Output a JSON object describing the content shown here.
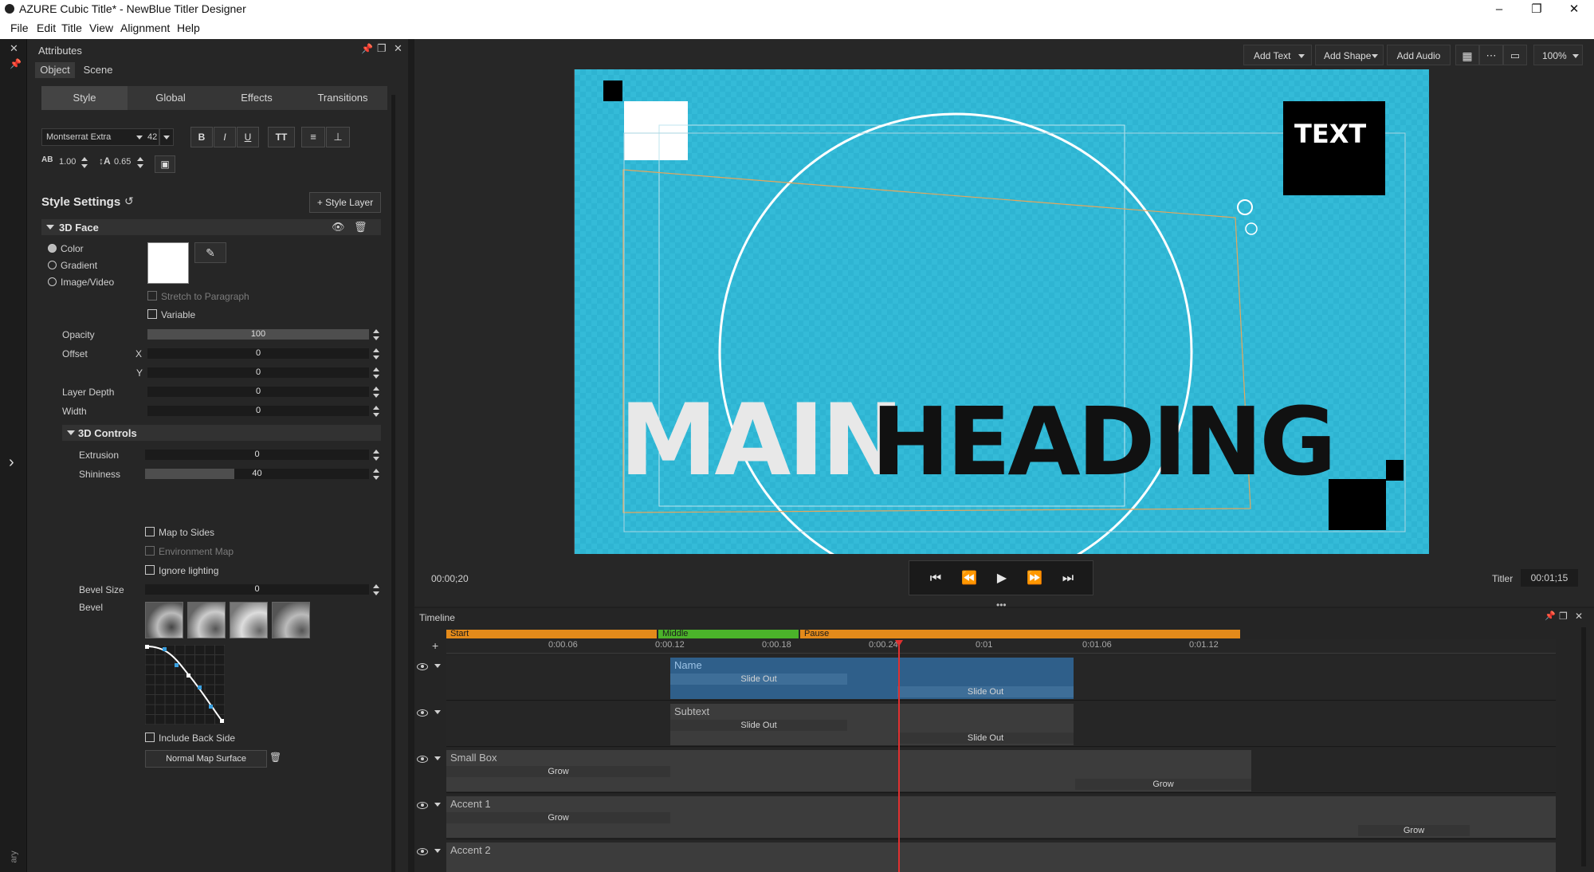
{
  "window": {
    "title": "AZURE Cubic Title* - NewBlue Titler Designer",
    "minimize": "–",
    "maximize": "❐",
    "close": "✕"
  },
  "menu": [
    "File",
    "Edit",
    "Title",
    "View",
    "Alignment",
    "Help"
  ],
  "panel": {
    "title": "Attributes",
    "tabs": [
      "Object",
      "Scene"
    ],
    "subtabs": [
      "Style",
      "Global",
      "Effects",
      "Transitions"
    ],
    "font": {
      "family": "Montserrat Extra",
      "size": "42"
    },
    "format": {
      "bold": "B",
      "italic": "I",
      "underline": "U",
      "case": "TT"
    },
    "tracking": "1.00",
    "leading": "0.65",
    "style_settings": "Style Settings",
    "style_layer_btn": "+ Style Layer",
    "face_section": "3D Face",
    "fill_options": [
      "Color",
      "Gradient",
      "Image/Video"
    ],
    "fill_selected": "Color",
    "face_color": "#ffffff",
    "stretch_label": "Stretch to Paragraph",
    "variable_label": "Variable",
    "opacity_label": "Opacity",
    "opacity_value": "100",
    "offset_label": "Offset",
    "offset_x_label": "X",
    "offset_x": "0",
    "offset_y_label": "Y",
    "offset_y": "0",
    "layer_depth_label": "Layer Depth",
    "layer_depth": "0",
    "width_label": "Width",
    "width_value": "0",
    "controls_section": "3D Controls",
    "extrusion_label": "Extrusion",
    "extrusion": "0",
    "shininess_label": "Shininess",
    "shininess": "40",
    "shininess_level": 0.4,
    "map_sides": "Map to Sides",
    "env_map": "Environment Map",
    "ignore_lighting": "Ignore lighting",
    "bevel_size_label": "Bevel Size",
    "bevel_size": "0",
    "bevel_label": "Bevel",
    "include_back": "Include Back Side",
    "normal_map": "Normal Map Surface",
    "left_strip_label": "ary"
  },
  "viewer": {
    "add_text": "Add Text",
    "add_shape": "Add Shape",
    "add_audio": "Add Audio",
    "zoom": "100%",
    "canvas_color": "#2eb4d2",
    "main_word": "MAIN",
    "heading_word": "HEADING",
    "box_text": "TEXT",
    "current_time": "00:00;20",
    "titler_label": "Titler",
    "duration": "00:01;15"
  },
  "timeline": {
    "title": "Timeline",
    "segments": [
      {
        "label": "Start",
        "color": "#e38a1a"
      },
      {
        "label": "Middle",
        "color": "#4bb32a"
      },
      {
        "label": "Pause",
        "color": "#e38a1a"
      }
    ],
    "ticks": [
      "0:00.06",
      "0:00.12",
      "0:00.18",
      "0:00.24",
      "0:01",
      "0:01.06",
      "0:01.12"
    ],
    "tracks": [
      {
        "name": "Name",
        "anim_in": "Slide Out",
        "anim_out": "Slide Out"
      },
      {
        "name": "Subtext",
        "anim_in": "Slide Out",
        "anim_out": "Slide Out"
      },
      {
        "name": "Small Box",
        "anim_in": "Grow",
        "anim_out": "Grow"
      },
      {
        "name": "Accent 1",
        "anim_in": "Grow",
        "anim_out": "Grow"
      },
      {
        "name": "Accent 2"
      }
    ]
  }
}
